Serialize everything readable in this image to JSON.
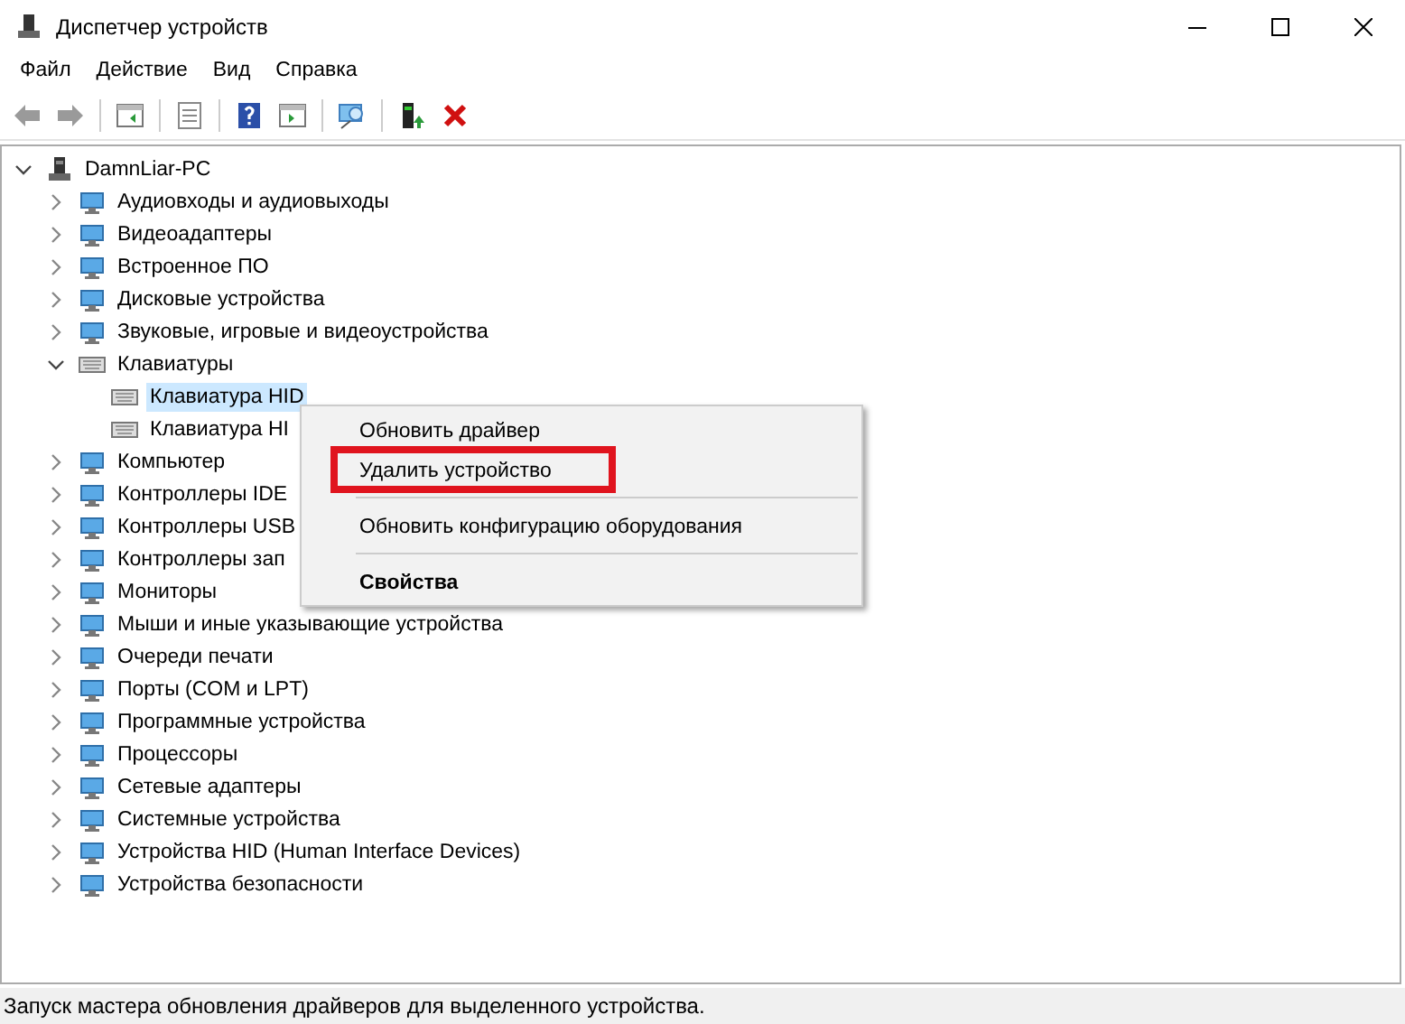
{
  "window": {
    "title": "Диспетчер устройств"
  },
  "menu_bar": [
    "Файл",
    "Действие",
    "Вид",
    "Справка"
  ],
  "tree": {
    "label": "DamnLiar-PC",
    "expanded": true,
    "children": [
      {
        "label": "Аудиовходы и аудиовыходы",
        "expanded": false
      },
      {
        "label": "Видеоадаптеры",
        "expanded": false
      },
      {
        "label": "Встроенное ПО",
        "expanded": false
      },
      {
        "label": "Дисковые устройства",
        "expanded": false
      },
      {
        "label": "Звуковые, игровые и видеоустройства",
        "expanded": false
      },
      {
        "label": "Клавиатуры",
        "expanded": true,
        "children": [
          {
            "label": "Клавиатура HID",
            "selected": true
          },
          {
            "label": "Клавиатура HI",
            "selected": false
          }
        ]
      },
      {
        "label": "Компьютер",
        "expanded": false
      },
      {
        "label": "Контроллеры IDE",
        "expanded": false
      },
      {
        "label": "Контроллеры USB",
        "expanded": false
      },
      {
        "label": "Контроллеры зап",
        "expanded": false
      },
      {
        "label": "Мониторы",
        "expanded": false
      },
      {
        "label": "Мыши и иные указывающие устройства",
        "expanded": false
      },
      {
        "label": "Очереди печати",
        "expanded": false
      },
      {
        "label": "Порты (COM и LPT)",
        "expanded": false
      },
      {
        "label": "Программные устройства",
        "expanded": false
      },
      {
        "label": "Процессоры",
        "expanded": false
      },
      {
        "label": "Сетевые адаптеры",
        "expanded": false
      },
      {
        "label": "Системные устройства",
        "expanded": false
      },
      {
        "label": "Устройства HID (Human Interface Devices)",
        "expanded": false
      },
      {
        "label": "Устройства безопасности",
        "expanded": false
      }
    ]
  },
  "context_menu": [
    {
      "kind": "item",
      "label": "Обновить драйвер",
      "highlighted": false,
      "bold": false
    },
    {
      "kind": "item",
      "label": "Удалить устройство",
      "highlighted": true,
      "bold": false
    },
    {
      "kind": "separator"
    },
    {
      "kind": "item",
      "label": "Обновить конфигурацию оборудования",
      "highlighted": false,
      "bold": false
    },
    {
      "kind": "separator"
    },
    {
      "kind": "item",
      "label": "Свойства",
      "highlighted": false,
      "bold": true
    }
  ],
  "status_bar": "Запуск мастера обновления драйверов для выделенного устройства."
}
